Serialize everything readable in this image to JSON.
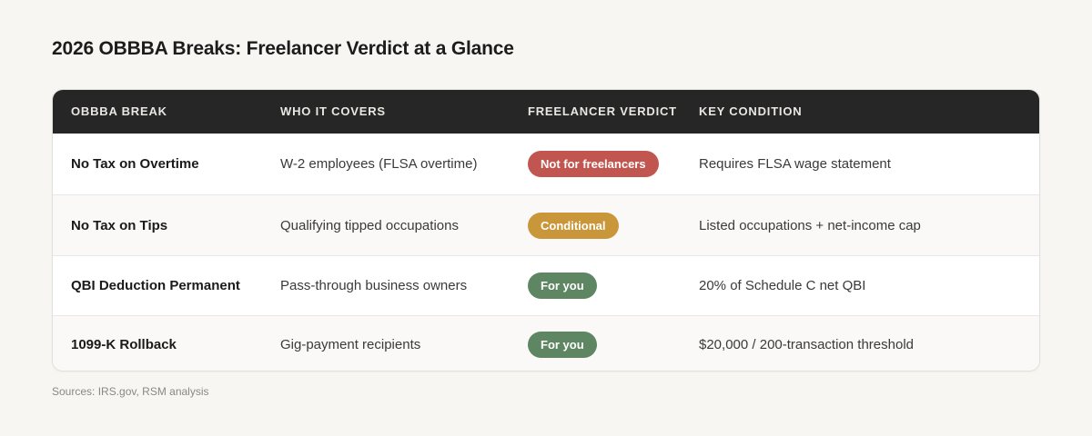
{
  "title": "2026 OBBBA Breaks: Freelancer Verdict at a Glance",
  "table": {
    "headers": [
      "OBBBA BREAK",
      "WHO IT COVERS",
      "FREELANCER VERDICT",
      "KEY CONDITION"
    ],
    "rows": [
      {
        "break": "No Tax on Overtime",
        "covers": "W-2 employees (FLSA overtime)",
        "verdict": "Not for freelancers",
        "verdict_color": "#c0564f",
        "condition": "Requires FLSA wage statement"
      },
      {
        "break": "No Tax on Tips",
        "covers": "Qualifying tipped occupations",
        "verdict": "Conditional",
        "verdict_color": "#c9963a",
        "condition": "Listed occupations + net-income cap"
      },
      {
        "break": "QBI Deduction Permanent",
        "covers": "Pass-through business owners",
        "verdict": "For you",
        "verdict_color": "#5e8662",
        "condition": "20% of Schedule C net QBI"
      },
      {
        "break": "1099-K Rollback",
        "covers": "Gig-payment recipients",
        "verdict": "For you",
        "verdict_color": "#5e8662",
        "condition": "$20,000 / 200-transaction threshold"
      }
    ]
  },
  "source": "Sources: IRS.gov, RSM analysis"
}
